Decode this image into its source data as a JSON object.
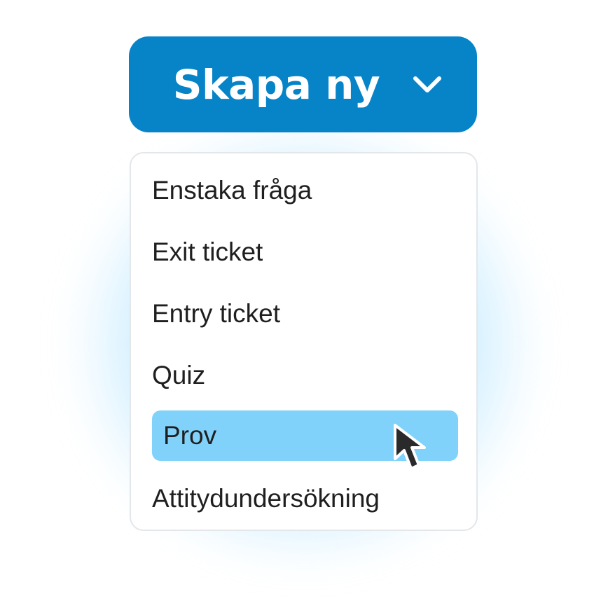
{
  "create_button": {
    "label": "Skapa ny",
    "icon": "chevron-down-icon",
    "color": "#0784c8"
  },
  "menu": {
    "items": [
      {
        "label": "Enstaka fråga",
        "selected": false
      },
      {
        "label": "Exit ticket",
        "selected": false
      },
      {
        "label": "Entry ticket",
        "selected": false
      },
      {
        "label": "Quiz",
        "selected": false
      },
      {
        "label": "Prov",
        "selected": true
      },
      {
        "label": "Attitydundersökning",
        "selected": false
      }
    ],
    "highlight_color": "#80d2fb"
  },
  "pointer": {
    "icon": "mouse-pointer-icon"
  }
}
